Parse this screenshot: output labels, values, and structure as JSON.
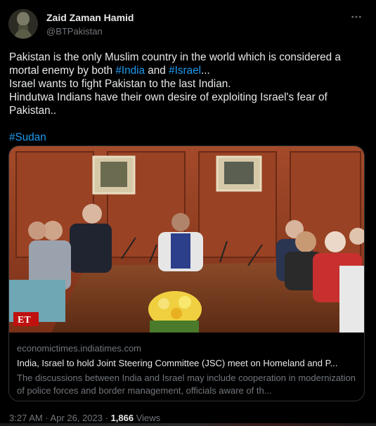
{
  "author": {
    "display_name": "Zaid Zaman Hamid",
    "handle": "@BTPakistan"
  },
  "tweet": {
    "segments": [
      [
        {
          "t": "Pakistan is the only Muslim country in the world which is considered a",
          "tag": false
        }
      ],
      [
        {
          "t": "mortal enemy by both ",
          "tag": false
        },
        {
          "t": "#India",
          "tag": true
        },
        {
          "t": " and ",
          "tag": false
        },
        {
          "t": "#Israel",
          "tag": true
        },
        {
          "t": "...",
          "tag": false
        }
      ],
      [
        {
          "t": "Israel wants to fight Pakistan to the last Indian.",
          "tag": false
        }
      ],
      [
        {
          "t": "Hindutwa Indians have their own desire of exploiting Israel's fear of",
          "tag": false
        }
      ],
      [
        {
          "t": "Pakistan..",
          "tag": false
        }
      ],
      [],
      [
        {
          "t": "#Sudan",
          "tag": true
        }
      ]
    ]
  },
  "card": {
    "domain": "economictimes.indiatimes.com",
    "title": "India, Israel to hold Joint Steering Committee (JSC) meet on Homeland and P...",
    "description": "The discussions between India and Israel may include cooperation in modernization of police forces and border management, officials aware of th...",
    "image_watermark": "ET"
  },
  "meta": {
    "time": "3:27 AM",
    "separator1": " · ",
    "date": "Apr 26, 2023",
    "separator2": " · ",
    "views_count": "1,866",
    "views_label": " Views"
  },
  "colors": {
    "background": "#000000",
    "text": "#e7e9ea",
    "muted": "#71767b",
    "link": "#1d9bf0",
    "border": "#2f3336"
  },
  "icons": {
    "more": "more-horizontal-icon"
  }
}
